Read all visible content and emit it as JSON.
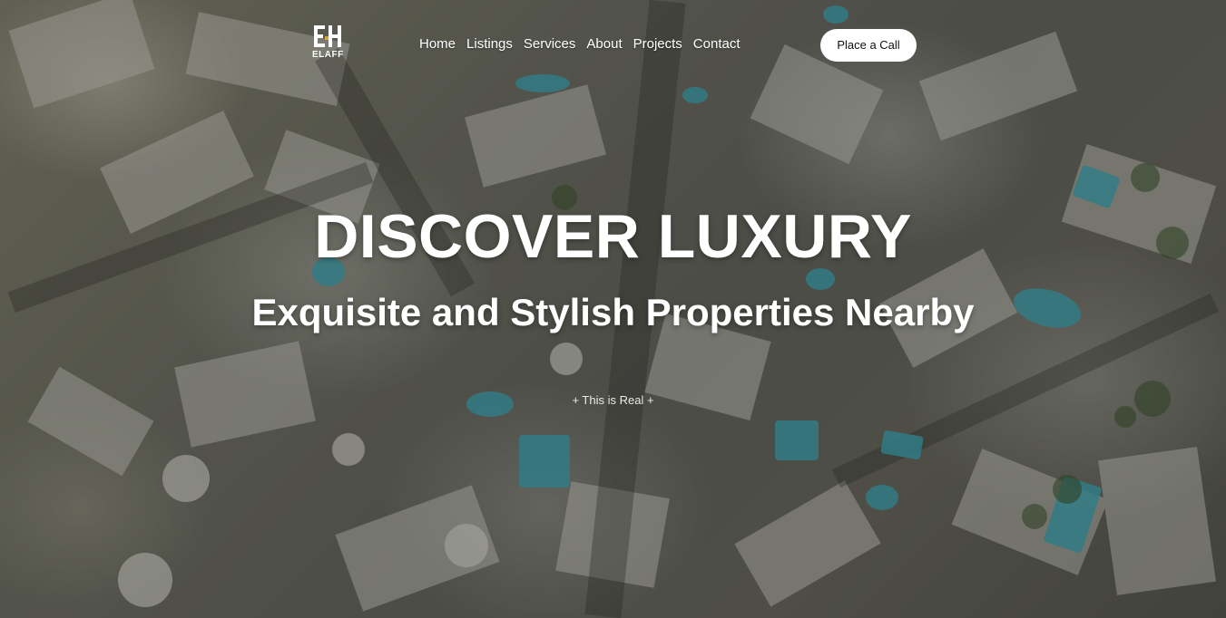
{
  "header": {
    "logo_text": "ELAFF",
    "nav": [
      {
        "label": "Home"
      },
      {
        "label": "Listings"
      },
      {
        "label": "Services"
      },
      {
        "label": "About"
      },
      {
        "label": "Projects"
      },
      {
        "label": "Contact"
      }
    ],
    "cta_label": "Place a Call"
  },
  "hero": {
    "headline": "DISCOVER LUXURY",
    "subheadline": "Exquisite and Stylish Properties Nearby",
    "tagline": "+ This is Real +",
    "background_image": "aerial-village-photo"
  },
  "colors": {
    "text": "#ffffff",
    "cta_background": "#ffffff",
    "cta_text": "#111111",
    "pool_accent": "#3fb7c9"
  }
}
